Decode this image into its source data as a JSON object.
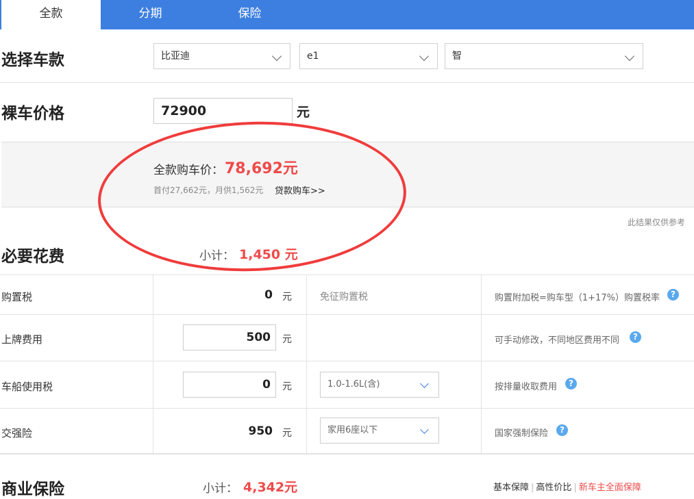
{
  "tabs": [
    {
      "label": "全款"
    },
    {
      "label": "分期"
    },
    {
      "label": "保险"
    }
  ],
  "select_model": {
    "title": "选择车款",
    "brand": "比亚迪",
    "series": "e1",
    "trim": "智"
  },
  "bare_price": {
    "title": "裸车价格",
    "value": "72900",
    "unit": "元"
  },
  "result": {
    "label": "全款购车价：",
    "value": "78,692元",
    "sub": "首付27,662元，月供1,562元",
    "loan_link": "贷款购车>>"
  },
  "reference_note": "此结果仅供参考",
  "required_fees": {
    "title": "必要花费",
    "subtotal_label": "小计：",
    "subtotal_value": "1,450 元",
    "rows": [
      {
        "label": "购置税",
        "value": "0",
        "unit": "元",
        "note": "免征购置税",
        "desc": "购置附加税=购车型（1+17%）购置税率"
      },
      {
        "label": "上牌费用",
        "value": "500",
        "unit": "元",
        "desc": "可手动修改，不同地区费用不同"
      },
      {
        "label": "车船使用税",
        "value": "0",
        "unit": "元",
        "option": "1.0-1.6L(含)",
        "desc": "按排量收取费用"
      },
      {
        "label": "交强险",
        "value": "950",
        "unit": "元",
        "option": "家用6座以下",
        "desc": "国家强制保险"
      }
    ]
  },
  "commercial_insurance": {
    "title": "商业保险",
    "subtotal_label": "小计：",
    "subtotal_value": "4,342元",
    "links": [
      "基本保障",
      "高性价比",
      "新车主全面保障"
    ]
  },
  "colors": {
    "tab_bar": "#3d7fe0",
    "accent_red": "#ef4a4a",
    "help_icon": "#5aa9ef",
    "annotation_circle": "#f03c3c"
  },
  "icons": {
    "help": "question-mark-icon",
    "dropdown": "chevron-down-icon"
  }
}
